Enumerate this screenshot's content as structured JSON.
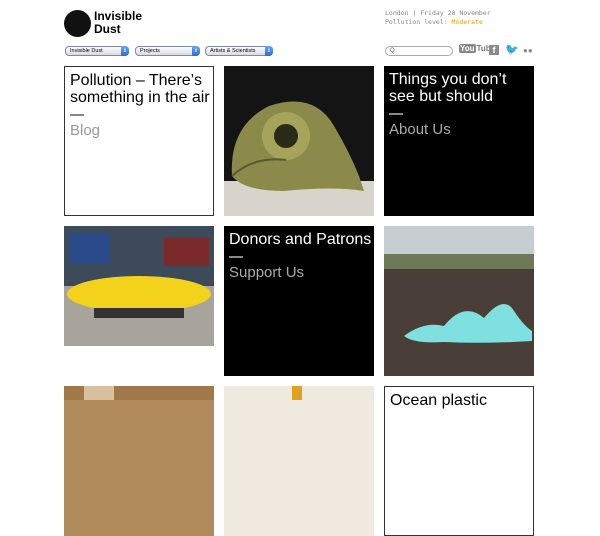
{
  "header": {
    "logo_line1": "Invisible",
    "logo_line2": "Dust",
    "location_date": "London | Friday 28 November",
    "pollution_label": "Pollution level:",
    "pollution_value": "Moderate",
    "pollution_color": "#e8a000"
  },
  "nav": {
    "selects": [
      {
        "value": "Invisible Dust"
      },
      {
        "value": "Projects"
      },
      {
        "value": "Artists & Scientists"
      }
    ],
    "search_placeholder": "Q",
    "social": [
      "youtube-icon",
      "facebook-icon",
      "twitter-icon",
      "flickr-icon"
    ],
    "youtube_label_1": "You",
    "youtube_label_2": "Tube"
  },
  "tiles": {
    "blog": {
      "title": "Pollution – There’s something in the air",
      "link": "Blog"
    },
    "about": {
      "title": "Things you don’t see but should",
      "link": "About Us"
    },
    "support": {
      "title": "Donors and Patrons",
      "link": "Support Us"
    },
    "ocean": {
      "title": "Ocean plastic"
    }
  }
}
